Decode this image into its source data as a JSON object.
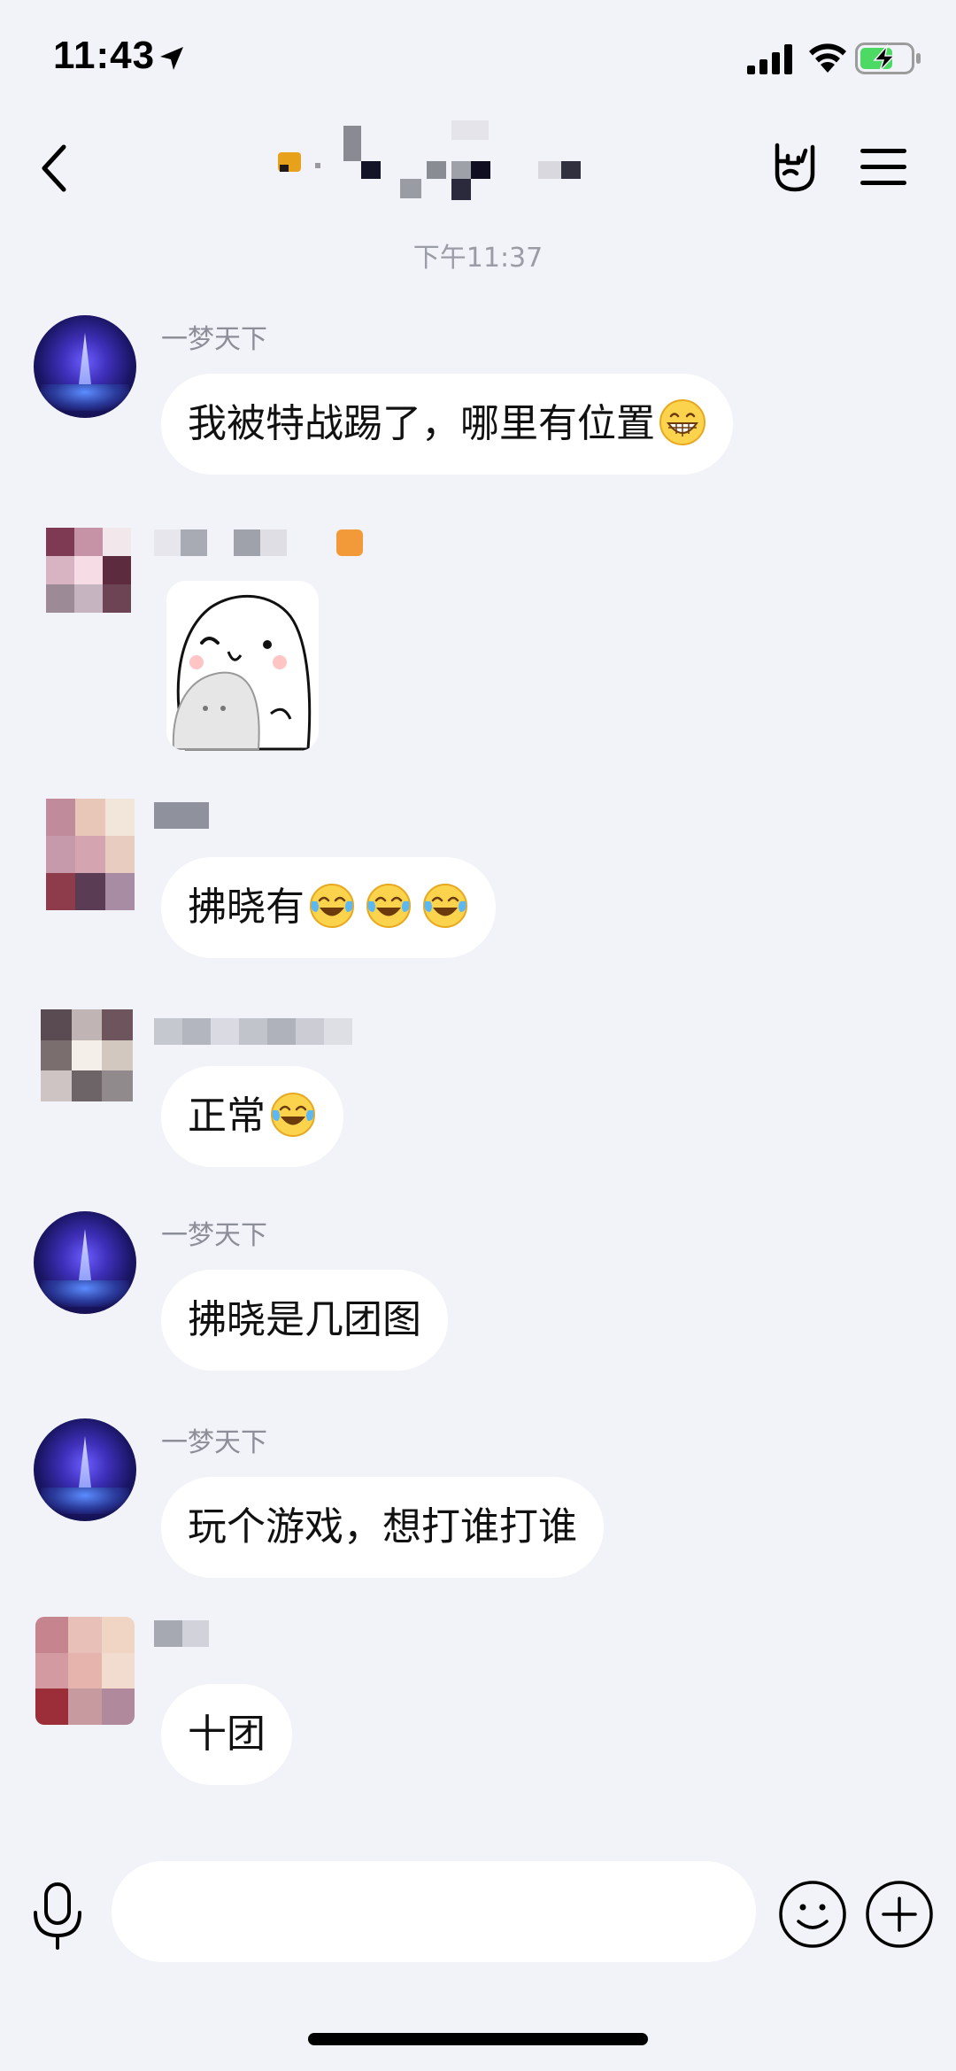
{
  "status_bar": {
    "time": "11:43",
    "icons": [
      "location-arrow-icon",
      "cellular-signal-icon",
      "wifi-icon",
      "battery-charging-icon"
    ],
    "battery_color": "#4cd964"
  },
  "nav": {
    "icons": [
      "chevron-left-icon",
      "rock-hand-icon",
      "menu-icon"
    ]
  },
  "chat": {
    "timestamp": "下午11:37",
    "messages": [
      {
        "sender": "一梦天下",
        "text": "我被特战踢了，哪里有位置",
        "emoji": "grinning-face-icon"
      },
      {
        "sender": "",
        "sticker": "white-bun-character-sticker"
      },
      {
        "sender": "",
        "text": "拂晓有",
        "emoji": "tears-of-joy-icon",
        "emoji_count": 3
      },
      {
        "sender": "",
        "text": "正常",
        "emoji": "tears-of-joy-icon"
      },
      {
        "sender": "一梦天下",
        "text": "拂晓是几团图"
      },
      {
        "sender": "一梦天下",
        "text": "玩个游戏，想打谁打谁"
      },
      {
        "sender": "",
        "text": "十团"
      }
    ]
  },
  "input_bar": {
    "value": "",
    "placeholder": "",
    "icons": [
      "microphone-icon",
      "smiley-face-icon",
      "plus-icon"
    ]
  },
  "colors": {
    "background": "#f2f3f8",
    "bubble": "#ffffff",
    "secondary_text": "#8d8f98"
  }
}
